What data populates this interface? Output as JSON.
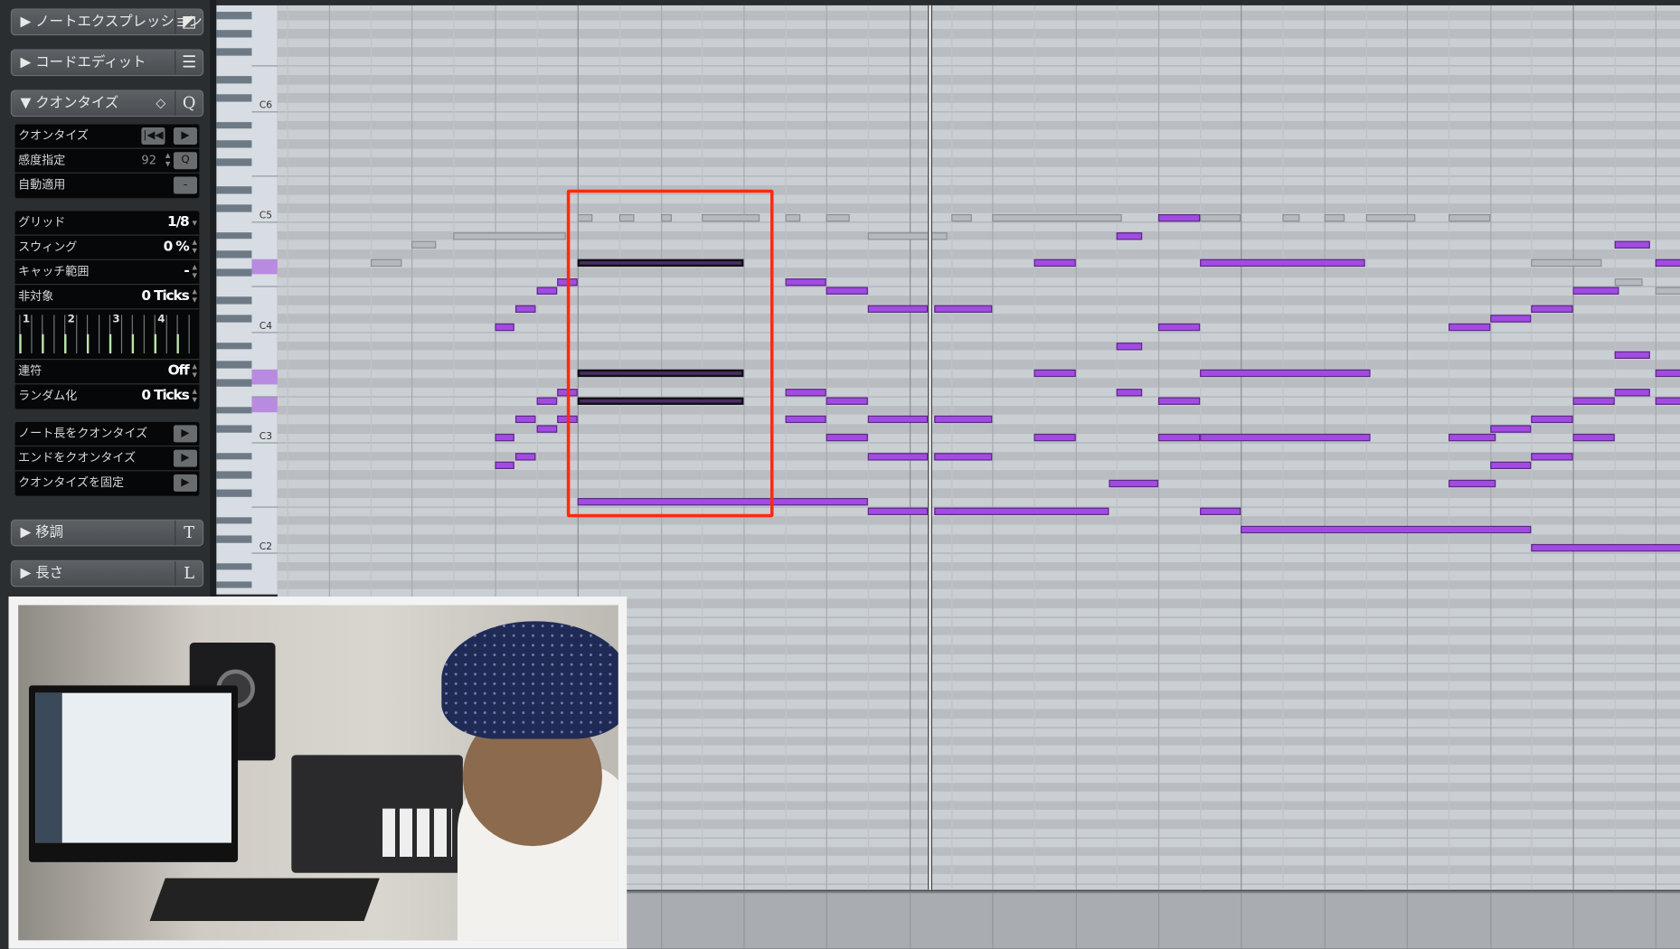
{
  "panel": {
    "note_expression": {
      "label": "ノートエクスプレッション",
      "icon": "expression-icon"
    },
    "chord_edit": {
      "label": "コードエディット",
      "icon": "chord-icon"
    },
    "quantize": {
      "label": "クオンタイズ",
      "header_icons": [
        "diamond-icon",
        "Q"
      ],
      "quantize_row": {
        "label": "クオンタイズ"
      },
      "sensitivity": {
        "label": "感度指定",
        "value": "92",
        "button": "Q"
      },
      "auto_apply": {
        "label": "自動適用",
        "button": "-"
      },
      "grid": {
        "label": "グリッド",
        "value": "1/8"
      },
      "swing": {
        "label": "スウィング",
        "value": "0 %"
      },
      "catch_range": {
        "label": "キャッチ範囲",
        "value": "-"
      },
      "non_quantize": {
        "label": "非対象",
        "value": "0 Ticks"
      },
      "beat_numbers": [
        "1",
        "2",
        "3",
        "4"
      ],
      "tuplet": {
        "label": "連符",
        "value": "Off"
      },
      "randomize": {
        "label": "ランダム化",
        "value": "0 Ticks"
      },
      "actions": [
        "ノート長をクオンタイズ",
        "エンドをクオンタイズ",
        "クオンタイズを固定"
      ]
    },
    "transpose": {
      "label": "移調",
      "shortcut": "T"
    },
    "length": {
      "label": "長さ",
      "shortcut": "L"
    }
  },
  "keyboard": {
    "labels": [
      {
        "name": "C6",
        "pitch": 84
      },
      {
        "name": "C5",
        "pitch": 72
      },
      {
        "name": "C4",
        "pitch": 60
      },
      {
        "name": "C3",
        "pitch": 48
      },
      {
        "name": "C2",
        "pitch": 36
      }
    ],
    "highlighted_pitches": [
      67,
      55,
      52
    ]
  },
  "colors": {
    "note": "#a24be3",
    "other_track_note": "#b5babf",
    "selection_box": "#ff2a10",
    "grid": "#cacfd4"
  },
  "grid": {
    "quantize": "1/8",
    "bar_beats": 4,
    "first_bar_beat": 3,
    "playhead_beat": 7.27
  },
  "notes": [
    [
      72,
      3.0,
      0.18,
      "o"
    ],
    [
      72,
      3.5,
      0.18,
      "o"
    ],
    [
      72,
      4.0,
      0.13,
      "o"
    ],
    [
      72,
      4.5,
      0.69,
      "o"
    ],
    [
      72,
      5.5,
      0.18,
      "o"
    ],
    [
      72,
      6.0,
      0.28,
      "o"
    ],
    [
      72,
      7.5,
      0.25,
      "o"
    ],
    [
      72,
      8.0,
      1.56,
      "o"
    ],
    [
      72,
      10.5,
      0.5,
      "o"
    ],
    [
      72,
      11.5,
      0.2,
      "o"
    ],
    [
      72,
      12.0,
      0.25,
      "o"
    ],
    [
      72,
      12.5,
      0.6,
      "o"
    ],
    [
      72,
      13.5,
      0.5,
      "o"
    ],
    [
      70,
      1.5,
      1.36,
      "o"
    ],
    [
      70,
      6.5,
      0.95,
      "o"
    ],
    [
      69,
      1.0,
      0.29,
      "o"
    ],
    [
      67,
      0.5,
      0.38,
      "o"
    ],
    [
      67,
      14.5,
      0.85,
      "o"
    ],
    [
      65,
      15.5,
      0.34,
      "o"
    ],
    [
      64,
      16.0,
      0.3,
      "o"
    ],
    [
      72,
      10,
      0.5,
      "a"
    ],
    [
      70,
      9.5,
      0.3,
      "a"
    ],
    [
      69,
      15.5,
      0.43,
      "a"
    ],
    [
      67,
      3,
      2,
      "s"
    ],
    [
      67,
      8.5,
      0.5,
      "a"
    ],
    [
      67,
      10.5,
      2,
      "a"
    ],
    [
      67,
      16,
      0.3,
      "a"
    ],
    [
      65,
      2.75,
      0.25,
      "a"
    ],
    [
      65,
      5.5,
      0.5,
      "a"
    ],
    [
      64,
      2.5,
      0.25,
      "a"
    ],
    [
      64,
      6,
      0.5,
      "a"
    ],
    [
      64,
      15,
      0.55,
      "a"
    ],
    [
      62,
      2.25,
      0.25,
      "a"
    ],
    [
      62,
      6.5,
      0.72,
      "a"
    ],
    [
      62,
      7.3,
      0.7,
      "a"
    ],
    [
      62,
      14.5,
      0.5,
      "a"
    ],
    [
      61,
      14,
      0.5,
      "a"
    ],
    [
      60,
      2,
      0.23,
      "a"
    ],
    [
      60,
      10,
      0.5,
      "a"
    ],
    [
      60,
      13.5,
      0.5,
      "a"
    ],
    [
      58,
      9.5,
      0.3,
      "a"
    ],
    [
      57,
      15.5,
      0.43,
      "a"
    ],
    [
      55,
      3,
      2,
      "s"
    ],
    [
      55,
      8.5,
      0.5,
      "a"
    ],
    [
      55,
      10.5,
      2.06,
      "a"
    ],
    [
      55,
      16,
      0.3,
      "a"
    ],
    [
      53,
      2.75,
      0.25,
      "a"
    ],
    [
      53,
      5.5,
      0.5,
      "a"
    ],
    [
      53,
      9.5,
      0.3,
      "a"
    ],
    [
      53,
      15.5,
      0.43,
      "a"
    ],
    [
      52,
      2.5,
      0.25,
      "a"
    ],
    [
      52,
      3,
      2,
      "s"
    ],
    [
      52,
      6,
      0.5,
      "a"
    ],
    [
      52,
      10,
      0.5,
      "a"
    ],
    [
      52,
      15,
      0.5,
      "a"
    ],
    [
      52,
      16,
      0.3,
      "a"
    ],
    [
      50,
      2.25,
      0.25,
      "a"
    ],
    [
      50,
      2.75,
      0.25,
      "a"
    ],
    [
      50,
      5.5,
      0.5,
      "a"
    ],
    [
      50,
      6.5,
      0.72,
      "a"
    ],
    [
      50,
      7.3,
      0.7,
      "a"
    ],
    [
      50,
      14.5,
      0.5,
      "a"
    ],
    [
      49,
      2.5,
      0.25,
      "a"
    ],
    [
      49,
      14,
      0.5,
      "a"
    ],
    [
      48,
      2,
      0.23,
      "a"
    ],
    [
      48,
      6,
      0.5,
      "a"
    ],
    [
      48,
      8.5,
      0.5,
      "a"
    ],
    [
      48,
      10,
      0.5,
      "a"
    ],
    [
      48,
      10.5,
      2.06,
      "a"
    ],
    [
      48,
      13.5,
      0.57,
      "a"
    ],
    [
      48,
      15,
      0.5,
      "a"
    ],
    [
      46,
      2.25,
      0.25,
      "a"
    ],
    [
      46,
      6.5,
      0.72,
      "a"
    ],
    [
      46,
      7.3,
      0.7,
      "a"
    ],
    [
      46,
      14.5,
      0.5,
      "a"
    ],
    [
      45,
      2,
      0.23,
      "a"
    ],
    [
      45,
      14,
      0.5,
      "a"
    ],
    [
      43,
      9.4,
      0.6,
      "a"
    ],
    [
      43,
      13.5,
      0.57,
      "a"
    ],
    [
      41,
      3,
      3.5,
      "a"
    ],
    [
      40,
      6.5,
      0.72,
      "a"
    ],
    [
      40,
      7.3,
      2.1,
      "a"
    ],
    [
      40,
      10.5,
      0.5,
      "a"
    ],
    [
      38,
      11,
      3.5,
      "a"
    ],
    [
      36,
      14.5,
      1.8,
      "a"
    ]
  ]
}
